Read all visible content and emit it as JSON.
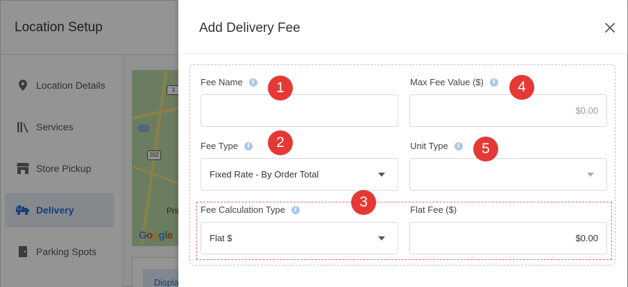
{
  "background": {
    "page_title": "Location Setup",
    "sidebar": [
      {
        "label": "Location Details",
        "icon": "map-pin-icon",
        "active": false
      },
      {
        "label": "Services",
        "icon": "services-icon",
        "active": false
      },
      {
        "label": "Store Pickup",
        "icon": "store-icon",
        "active": false
      },
      {
        "label": "Delivery",
        "icon": "delivery-truck-icon",
        "active": true
      },
      {
        "label": "Parking Spots",
        "icon": "parking-door-icon",
        "active": false
      }
    ],
    "map": {
      "shield_1": "202",
      "shield_2": "1",
      "place_label": "Prin",
      "logo": "Google"
    },
    "display_button_label": "Displa"
  },
  "drawer": {
    "title": "Add Delivery Fee",
    "close_icon": "close-icon",
    "fields": {
      "fee_name": {
        "label": "Fee Name",
        "value": ""
      },
      "max_fee_value": {
        "label": "Max Fee Value ($)",
        "placeholder": "$0.00",
        "value": ""
      },
      "fee_type": {
        "label": "Fee Type",
        "value": "Fixed Rate - By Order Total"
      },
      "unit_type": {
        "label": "Unit Type",
        "value": ""
      },
      "fee_calculation_type": {
        "label": "Fee Calculation Type",
        "value": "Flat $"
      },
      "flat_fee": {
        "label": "Flat Fee ($)",
        "value": "$0.00"
      }
    },
    "info_icon": "i"
  },
  "annotations": [
    "1",
    "2",
    "3",
    "4",
    "5"
  ],
  "colors": {
    "marker": "#e53935",
    "active": "#2c6cc4",
    "info": "#a9c8ec",
    "highlight_border": "#e06b6b"
  }
}
